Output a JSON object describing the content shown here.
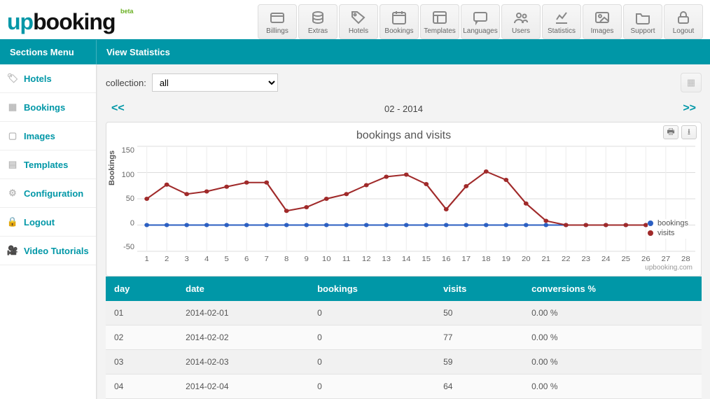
{
  "brand": {
    "up": "up",
    "booking": "booking",
    "beta": "beta"
  },
  "toolbar": {
    "billings": "Billings",
    "extras": "Extras",
    "hotels": "Hotels",
    "bookings": "Bookings",
    "templates": "Templates",
    "languages": "Languages",
    "users": "Users",
    "statistics": "Statistics",
    "images": "Images",
    "support": "Support",
    "logout": "Logout"
  },
  "bar": {
    "left": "Sections Menu",
    "right": "View Statistics"
  },
  "sidebar": {
    "items": [
      {
        "label": "Hotels",
        "icon": "tag-icon"
      },
      {
        "label": "Bookings",
        "icon": "calendar-icon"
      },
      {
        "label": "Images",
        "icon": "image-icon"
      },
      {
        "label": "Templates",
        "icon": "layout-icon"
      },
      {
        "label": "Configuration",
        "icon": "gear-icon"
      },
      {
        "label": "Logout",
        "icon": "lock-icon"
      },
      {
        "label": "Video Tutorials",
        "icon": "video-icon"
      }
    ]
  },
  "filters": {
    "collection_label": "collection:",
    "collection_value": "all"
  },
  "nav": {
    "prev": "<<",
    "period": "02 - 2014",
    "next": ">>"
  },
  "chart_data": {
    "type": "line",
    "title": "bookings and visits",
    "xlabel": "",
    "ylabel": "Bookings",
    "ylim": [
      -50,
      150
    ],
    "x": [
      1,
      2,
      3,
      4,
      5,
      6,
      7,
      8,
      9,
      10,
      11,
      12,
      13,
      14,
      15,
      16,
      17,
      18,
      19,
      20,
      21,
      22,
      23,
      24,
      25,
      26,
      27,
      28
    ],
    "series": [
      {
        "name": "bookings",
        "color": "#2b5fc2",
        "values": [
          0,
          0,
          0,
          0,
          0,
          0,
          0,
          0,
          0,
          0,
          0,
          0,
          0,
          0,
          0,
          0,
          0,
          0,
          0,
          0,
          0,
          0,
          0,
          0,
          0,
          0,
          0,
          0
        ]
      },
      {
        "name": "visits",
        "color": "#a02a2a",
        "values": [
          50,
          77,
          59,
          64,
          73,
          81,
          81,
          27,
          34,
          50,
          59,
          76,
          92,
          96,
          78,
          30,
          74,
          102,
          86,
          41,
          8,
          0,
          0,
          0,
          0,
          0,
          0,
          0
        ]
      }
    ],
    "credit": "upbooking.com"
  },
  "legend": {
    "bookings": "bookings",
    "visits": "visits"
  },
  "table": {
    "headers": {
      "day": "day",
      "date": "date",
      "bookings": "bookings",
      "visits": "visits",
      "conv": "conversions %"
    },
    "rows": [
      {
        "day": "01",
        "date": "2014-02-01",
        "bookings": "0",
        "visits": "50",
        "conv": "0.00 %"
      },
      {
        "day": "02",
        "date": "2014-02-02",
        "bookings": "0",
        "visits": "77",
        "conv": "0.00 %"
      },
      {
        "day": "03",
        "date": "2014-02-03",
        "bookings": "0",
        "visits": "59",
        "conv": "0.00 %"
      },
      {
        "day": "04",
        "date": "2014-02-04",
        "bookings": "0",
        "visits": "64",
        "conv": "0.00 %"
      }
    ]
  }
}
